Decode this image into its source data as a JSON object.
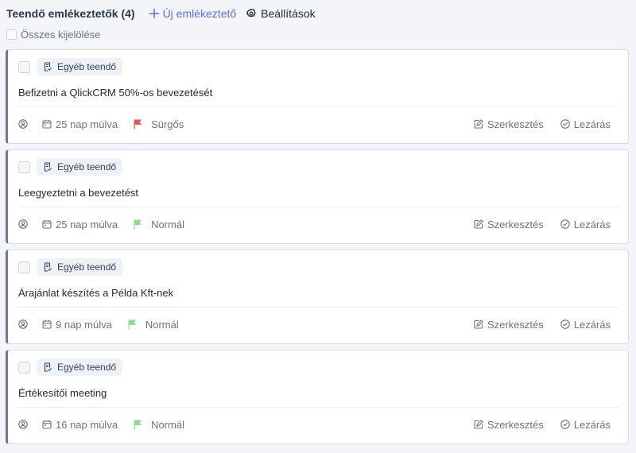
{
  "header": {
    "title": "Teendő emlékeztetők (4)",
    "new_label": "Új emlékeztető",
    "settings_label": "Beállítások"
  },
  "select_all_label": "Összes kijelölése",
  "actions": {
    "edit": "Szerkesztés",
    "close": "Lezárás"
  },
  "colors": {
    "urgent": "#f05252",
    "normal": "#8bdc8b",
    "accent": "#5b6cf0",
    "card_border": "#6c7a91"
  },
  "reminders": [
    {
      "category": "Egyéb teendő",
      "title": "Befizetni a QlickCRM 50%-os bevezetését",
      "due": "25 nap múlva",
      "priority": "Sürgős",
      "priority_level": "urgent"
    },
    {
      "category": "Egyéb teendő",
      "title": "Leegyeztetni a bevezetést",
      "due": "25 nap múlva",
      "priority": "Normál",
      "priority_level": "normal"
    },
    {
      "category": "Egyéb teendő",
      "title": "Árajánlat készítés a Példa Kft-nek",
      "due": "9 nap múlva",
      "priority": "Normál",
      "priority_level": "normal"
    },
    {
      "category": "Egyéb teendő",
      "title": "Értékesítői meeting",
      "due": "16 nap múlva",
      "priority": "Normál",
      "priority_level": "normal"
    }
  ]
}
